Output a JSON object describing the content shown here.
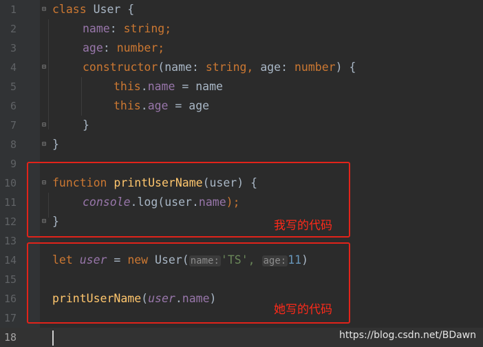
{
  "editor": {
    "line_numbers": [
      "1",
      "2",
      "3",
      "4",
      "5",
      "6",
      "7",
      "8",
      "9",
      "10",
      "11",
      "12",
      "13",
      "14",
      "15",
      "16",
      "17",
      "18"
    ],
    "code": {
      "l1_class": "class",
      "l1_name": "User",
      "l1_brace": "{",
      "l2_prop": "name",
      "l2_colon": ":",
      "l2_type": "string;",
      "l3_prop": "age",
      "l3_colon": ":",
      "l3_type": "number;",
      "l4_ctor": "constructor",
      "l4_open": "(name:",
      "l4_t1": "string,",
      "l4_mid": "age:",
      "l4_t2": "number",
      "l4_close": ") {",
      "l5_this": "this",
      "l5_dot": ".",
      "l5_prop": "name",
      "l5_rest": " = name",
      "l6_this": "this",
      "l6_dot": ".",
      "l6_prop": "age",
      "l6_rest": " = age",
      "l7_brace": "}",
      "l8_brace": "}",
      "l10_fn": "function",
      "l10_name": "printUserName",
      "l10_rest": "(user) {",
      "l11_console": "console",
      "l11_log": ".log(user.",
      "l11_prop": "name",
      "l11_end": ");",
      "l12_brace": "}",
      "l14_let": "let",
      "l14_var": "user",
      "l14_eq": " = ",
      "l14_new": "new",
      "l14_cls": " User(",
      "l14_hint1": "name:",
      "l14_str": "'TS',",
      "l14_hint2": "age:",
      "l14_num": "11",
      "l14_close": ")",
      "l16_fn": "printUserName",
      "l16_open": "(",
      "l16_var": "user",
      "l16_dot": ".",
      "l16_prop": "name",
      "l16_close": ")"
    }
  },
  "annotations": {
    "my_code": "我写的代码",
    "her_code": "她写的代码"
  },
  "watermark": "https://blog.csdn.net/BDawn",
  "colors": {
    "background": "#2b2b2b",
    "keyword": "#cc7832",
    "property": "#9876aa",
    "function": "#ffc66d",
    "string": "#6a8759",
    "number": "#6897bb",
    "annotation_red": "#e2231a"
  }
}
